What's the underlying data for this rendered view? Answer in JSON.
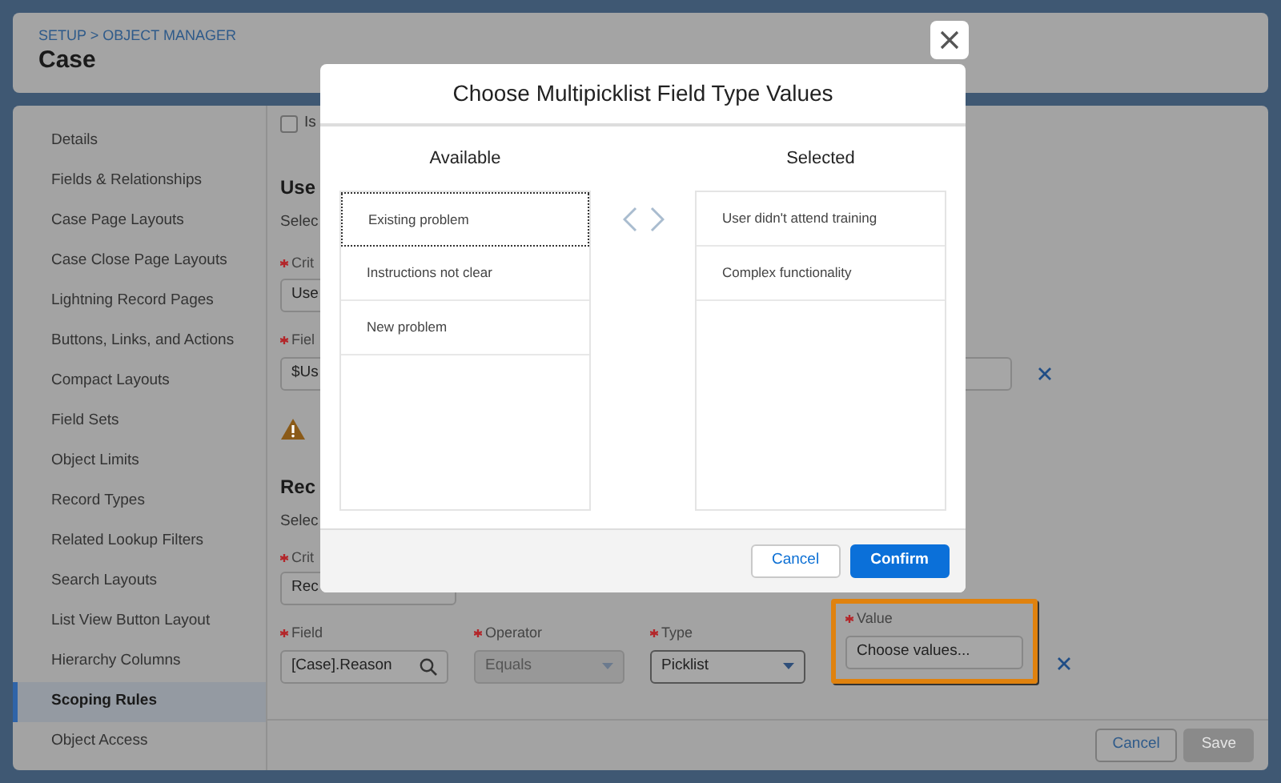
{
  "header": {
    "breadcrumb": "SETUP > OBJECT MANAGER",
    "title": "Case"
  },
  "sidebar": {
    "items": [
      {
        "label": "Details",
        "selected": false
      },
      {
        "label": "Fields & Relationships",
        "selected": false
      },
      {
        "label": "Case Page Layouts",
        "selected": false
      },
      {
        "label": "Case Close Page Layouts",
        "selected": false
      },
      {
        "label": "Lightning Record Pages",
        "selected": false
      },
      {
        "label": "Buttons, Links, and Actions",
        "selected": false
      },
      {
        "label": "Compact Layouts",
        "selected": false
      },
      {
        "label": "Field Sets",
        "selected": false
      },
      {
        "label": "Object Limits",
        "selected": false
      },
      {
        "label": "Record Types",
        "selected": false
      },
      {
        "label": "Related Lookup Filters",
        "selected": false
      },
      {
        "label": "Search Layouts",
        "selected": false
      },
      {
        "label": "List View Button Layout",
        "selected": false
      },
      {
        "label": "Hierarchy Columns",
        "selected": false
      },
      {
        "label": "Scoping Rules",
        "selected": true
      },
      {
        "label": "Object Access",
        "selected": false
      }
    ]
  },
  "form": {
    "checkbox": {
      "label": "Is",
      "checked": false
    },
    "user_section": {
      "heading": "Use",
      "description": "Selec",
      "criteria": {
        "label": "Crit",
        "value": "Use"
      },
      "field": {
        "label": "Fiel",
        "value": "$Us"
      }
    },
    "record_section": {
      "heading": "Rec",
      "description": "Selec",
      "criteria": {
        "label": "Crit",
        "value": "Rec"
      }
    },
    "condition": [
      {
        "kind": "lookup",
        "label": "Field",
        "value": "[Case].Reason",
        "disabled": false
      },
      {
        "kind": "select",
        "label": "Operator",
        "value": "Equals",
        "disabled": true
      },
      {
        "kind": "select",
        "label": "Type",
        "value": "Picklist",
        "disabled": false
      },
      {
        "kind": "chooser",
        "label": "Value",
        "value": "Choose values...",
        "highlighted": true
      }
    ]
  },
  "footer": {
    "buttons": [
      {
        "label": "Cancel",
        "disabled": false
      },
      {
        "label": "Save",
        "disabled": true
      }
    ]
  },
  "modal": {
    "title": "Choose Multipicklist Field Type Values",
    "available": {
      "heading": "Available",
      "items": [
        {
          "label": "Existing problem",
          "focused": true
        },
        {
          "label": "Instructions not clear",
          "focused": false
        },
        {
          "label": "New problem",
          "focused": false
        }
      ]
    },
    "selected": {
      "heading": "Selected",
      "items": [
        {
          "label": "User didn't attend training",
          "focused": false
        },
        {
          "label": "Complex functionality",
          "focused": false
        }
      ]
    },
    "buttons": [
      {
        "label": "Cancel",
        "kind": "neutral"
      },
      {
        "label": "Confirm",
        "kind": "brand"
      }
    ]
  }
}
